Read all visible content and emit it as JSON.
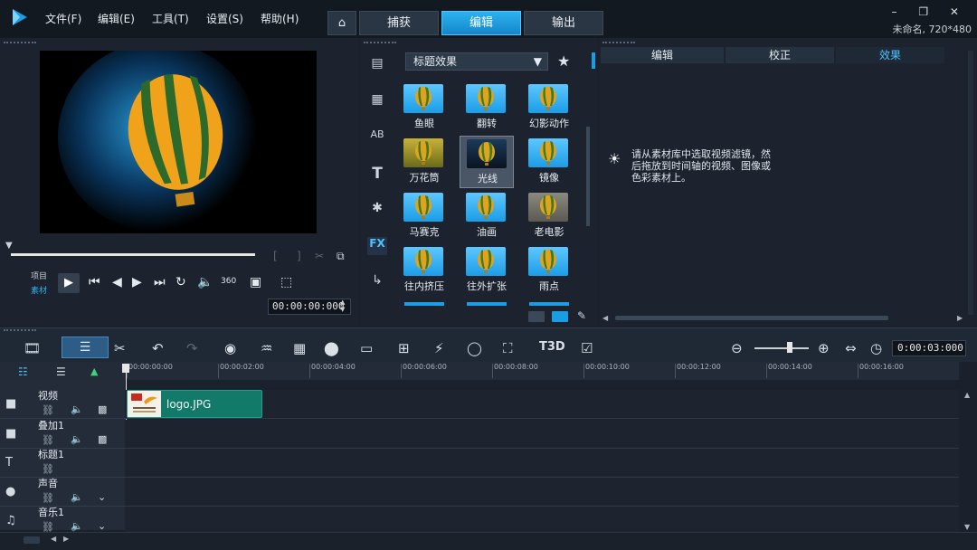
{
  "menu": {
    "items": [
      "文件(F)",
      "编辑(E)",
      "工具(T)",
      "设置(S)",
      "帮助(H)"
    ]
  },
  "mode_tabs": [
    "捕获",
    "编辑",
    "输出"
  ],
  "window": {
    "controls": "–  ❐  ✕",
    "project_info": "未命名, 720*480"
  },
  "player": {
    "project_label": "项目",
    "clip_label": "素材",
    "timecode": "00:00:00:000",
    "degree_label": "360"
  },
  "library": {
    "filter_dropdown": "标题效果",
    "effects": [
      {
        "label": "鱼眼"
      },
      {
        "label": "翻转"
      },
      {
        "label": "幻影动作"
      },
      {
        "label": "万花筒"
      },
      {
        "label": "光线"
      },
      {
        "label": "镜像"
      },
      {
        "label": "马赛克"
      },
      {
        "label": "油画"
      },
      {
        "label": "老电影"
      },
      {
        "label": "往内挤压"
      },
      {
        "label": "往外扩张"
      },
      {
        "label": "雨点"
      }
    ],
    "selected_index": 4,
    "fx_label": "FX"
  },
  "options": {
    "tabs": [
      "编辑",
      "校正",
      "效果"
    ],
    "active_tab": 2,
    "hint": "请从素材库中选取视频滤镜，然后拖放到时间轴的视频、图像或色彩素材上。"
  },
  "toolbar": {
    "timecode": "0:00:03:000",
    "title_3d": "T3D"
  },
  "timeline": {
    "ticks": [
      "00:00:00:00",
      "00:00:02:00",
      "00:00:04:00",
      "00:00:06:00",
      "00:00:08:00",
      "00:00:10:00",
      "00:00:12:00",
      "00:00:14:00",
      "00:00:16:00"
    ],
    "tracks": [
      "视频",
      "叠加1",
      "标题1",
      "声音",
      "音乐1"
    ],
    "clip_name": "logo.JPG"
  },
  "colors": {
    "accent": "#1a9ee3",
    "clip": "#137a6a"
  }
}
